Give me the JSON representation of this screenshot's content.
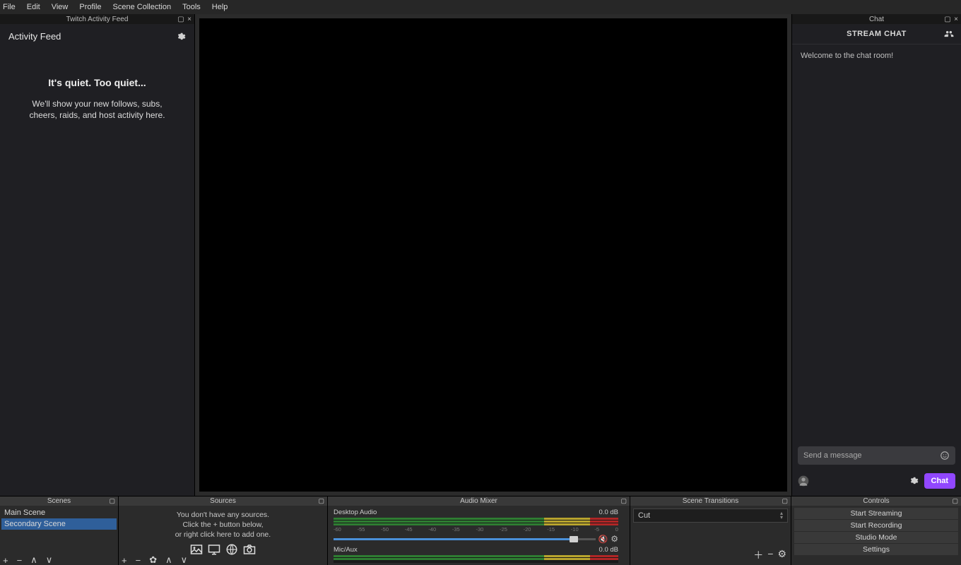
{
  "menubar": [
    "File",
    "Edit",
    "View",
    "Profile",
    "Scene Collection",
    "Tools",
    "Help"
  ],
  "docks": {
    "activity_tab": "Twitch Activity Feed",
    "chat_tab": "Chat"
  },
  "activity": {
    "title": "Activity Feed",
    "empty_title": "It's quiet. Too quiet...",
    "empty_line1": "We'll show your new follows, subs,",
    "empty_line2": "cheers, raids, and host activity here."
  },
  "chat": {
    "header": "STREAM CHAT",
    "welcome": "Welcome to the chat room!",
    "placeholder": "Send a message",
    "button": "Chat"
  },
  "scenes": {
    "header": "Scenes",
    "items": [
      "Main Scene",
      "Secondary Scene"
    ],
    "selected_index": 1
  },
  "sources": {
    "header": "Sources",
    "line1": "You don't have any sources.",
    "line2": "Click the + button below,",
    "line3": "or right click here to add one."
  },
  "mixer": {
    "header": "Audio Mixer",
    "channels": [
      {
        "name": "Desktop Audio",
        "level": "0.0 dB"
      },
      {
        "name": "Mic/Aux",
        "level": "0.0 dB"
      }
    ],
    "ticks": [
      "-60",
      "-55",
      "-50",
      "-45",
      "-40",
      "-35",
      "-30",
      "-25",
      "-20",
      "-15",
      "-10",
      "-5",
      "0"
    ]
  },
  "transitions": {
    "header": "Scene Transitions",
    "selected": "Cut"
  },
  "controls": {
    "header": "Controls",
    "buttons": [
      "Start Streaming",
      "Start Recording",
      "Studio Mode",
      "Settings"
    ]
  }
}
